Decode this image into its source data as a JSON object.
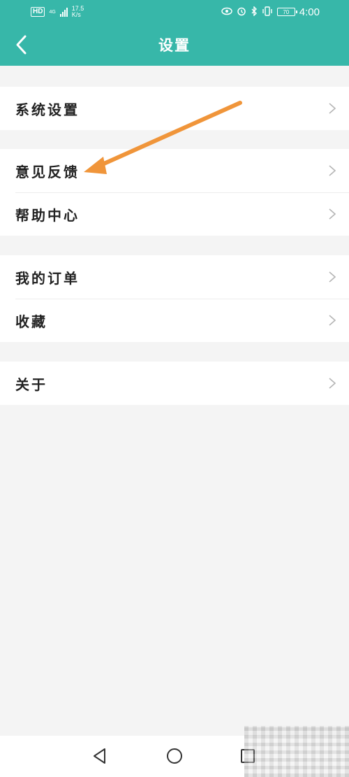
{
  "status_bar": {
    "hd_badge": "HD",
    "network_type": "4G",
    "speed_value": "17.5",
    "speed_unit": "K/s",
    "battery": "70",
    "time": "4:00"
  },
  "header": {
    "title": "设置"
  },
  "groups": [
    {
      "items": [
        {
          "label": "系统设置"
        }
      ]
    },
    {
      "items": [
        {
          "label": "意见反馈"
        },
        {
          "label": "帮助中心"
        }
      ]
    },
    {
      "items": [
        {
          "label": "我的订单"
        },
        {
          "label": "收藏"
        }
      ]
    },
    {
      "items": [
        {
          "label": "关于"
        }
      ]
    }
  ],
  "colors": {
    "primary": "#37b7a9",
    "annotation_arrow": "#f0953a",
    "background": "#f4f4f4"
  },
  "icons": {
    "back": "chevron-left-icon",
    "row": "chevron-right-icon",
    "nav_back": "triangle-back-icon",
    "nav_home": "circle-home-icon",
    "nav_recent": "square-recent-icon"
  }
}
